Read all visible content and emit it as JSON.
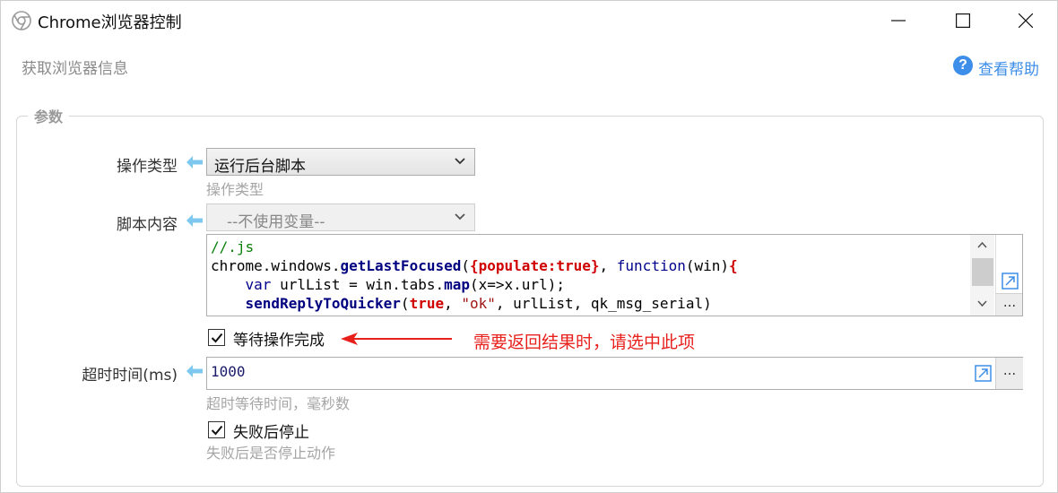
{
  "window": {
    "title": "Chrome浏览器控制"
  },
  "header": {
    "subtitle": "获取浏览器信息",
    "help_label": "查看帮助"
  },
  "group": {
    "legend": "参数"
  },
  "operation": {
    "label": "操作类型",
    "selected": "运行后台脚本",
    "hint": "操作类型"
  },
  "script": {
    "label": "脚本内容",
    "variable_select": "--不使用变量--",
    "code_lines": [
      "//.js",
      "chrome.windows.getLastFocused({populate:true}, function(win){",
      "    var urlList = win.tabs.map(x=>x.url);",
      "    sendReplyToQuicker(true, \"ok\", urlList, qk_msg_serial)"
    ],
    "more_label": "..."
  },
  "wait": {
    "label": "等待操作完成",
    "checked": true,
    "annotation": "需要返回结果时，请选中此项"
  },
  "timeout": {
    "label": "超时时间(ms)",
    "value": "1000",
    "hint": "超时等待时间，毫秒数",
    "more_label": "..."
  },
  "stop_on_fail": {
    "label": "失败后停止",
    "checked": true,
    "hint": "失败后是否停止动作"
  },
  "colors": {
    "accent": "#3d8ee8",
    "annotation": "#e8201c",
    "arrow": "#7ec8f0"
  }
}
